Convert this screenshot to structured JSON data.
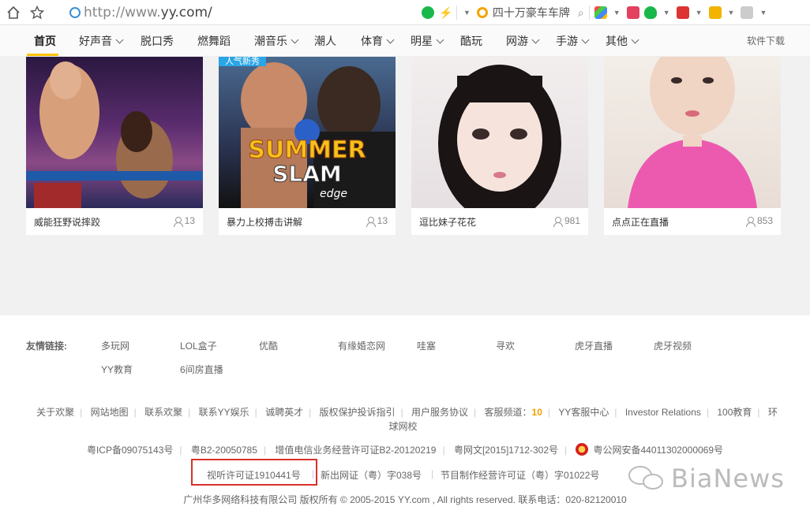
{
  "browser": {
    "url_host": "http://www.",
    "url_domain": "yy.com/",
    "hot_search": "四十万豪车车牌"
  },
  "nav": {
    "items": [
      "首页",
      "好声音",
      "脱口秀",
      "燃舞蹈",
      "潮音乐",
      "潮人",
      "体育",
      "明星",
      "酷玩",
      "网游",
      "手游",
      "其他"
    ],
    "download": "软件下载"
  },
  "cards": [
    {
      "title": "威能狂野说摔跤",
      "count": "13",
      "tag": ""
    },
    {
      "title": "暴力上校搏击讲解",
      "count": "13",
      "tag": "人气新秀"
    },
    {
      "title": "逗比妹子花花",
      "count": "981",
      "tag": ""
    },
    {
      "title": "点点正在直播",
      "count": "853",
      "tag": ""
    }
  ],
  "poster_text": {
    "line1": "SUMMER",
    "line2": "SLAM",
    "sponsor": "edge"
  },
  "friends": {
    "label": "友情链接:",
    "links": [
      "多玩网",
      "LOL盒子",
      "优酷",
      "有缘婚恋网",
      "哇塞",
      "寻欢",
      "虎牙直播",
      "虎牙视频",
      "YY教育",
      "6间房直播"
    ]
  },
  "footer_links": {
    "items": [
      "关于欢聚",
      "网站地图",
      "联系欢聚",
      "联系YY娱乐",
      "诚聘英才",
      "版权保护投诉指引",
      "用户服务协议"
    ],
    "service_label": "客服频道：",
    "service_num": "10",
    "items2": [
      "YY客服中心",
      "Investor Relations",
      "100教育",
      "环球网校"
    ]
  },
  "licenses": {
    "row1": [
      "粤ICP备09075143号",
      "粤B2-20050785",
      "增值电信业务经营许可证B2-20120219",
      "粤网文[2015]1712-302号",
      "粤公网安备44011302000069号"
    ],
    "row2": [
      "视听许可证1910441号",
      "新出网证（粤）字038号",
      "节目制作经营许可证（粤）字01022号"
    ]
  },
  "copyright": "广州华多网络科技有限公司 版权所有 © 2005-2015 YY.com , All rights reserved. 联系电话：020-82120010",
  "watermark": "BiaNews"
}
